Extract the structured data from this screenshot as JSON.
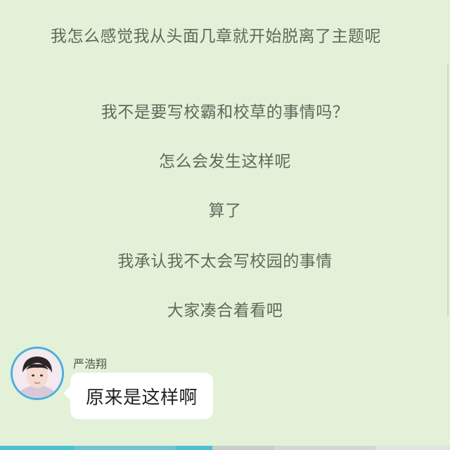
{
  "story": {
    "first_paragraph": "我怎么感觉我从头面几章就开始脱离了主题呢",
    "lines": [
      "我不是要写校霸和校草的事情吗？",
      "怎么会发生这样呢",
      "算了",
      "我承认我不太会写校园的事情",
      "大家凑合着看吧"
    ]
  },
  "dialogue": {
    "speaker_name": "严浩翔",
    "message": "原来是这样啊",
    "avatar_icon": "portrait-avatar-icon"
  },
  "colors": {
    "background": "#e3f1d9",
    "text": "#5e6a5a",
    "avatar_ring": "#4ab0dc",
    "bubble": "#ffffff"
  }
}
